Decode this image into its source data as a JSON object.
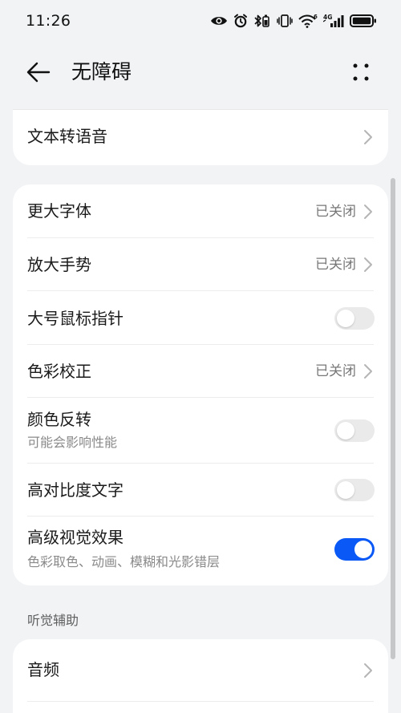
{
  "status_bar": {
    "time": "11:26",
    "icons": [
      "eye-comfort-icon",
      "alarm-icon",
      "bluetooth-icon",
      "vibrate-icon",
      "wifi-icon",
      "cellular-signal-icon",
      "battery-icon"
    ],
    "wifi_badge": "6",
    "signal_badge": "4G"
  },
  "app_bar": {
    "title": "无障碍"
  },
  "main": {
    "card1": {
      "items": [
        {
          "label": "文本转语音",
          "type": "link"
        }
      ]
    },
    "card2": {
      "items": [
        {
          "label": "更大字体",
          "value": "已关闭",
          "type": "link"
        },
        {
          "label": "放大手势",
          "value": "已关闭",
          "type": "link"
        },
        {
          "label": "大号鼠标指针",
          "type": "toggle",
          "checked": false
        },
        {
          "label": "色彩校正",
          "value": "已关闭",
          "type": "link"
        },
        {
          "label": "颜色反转",
          "subtitle": "可能会影响性能",
          "type": "toggle",
          "checked": false
        },
        {
          "label": "高对比度文字",
          "type": "toggle",
          "checked": false
        },
        {
          "label": "高级视觉效果",
          "subtitle": "色彩取色、动画、模糊和光影错层",
          "type": "toggle",
          "checked": true
        }
      ]
    },
    "section_hearing": {
      "title": "听觉辅助",
      "items": [
        {
          "label": "音频",
          "type": "link"
        }
      ]
    }
  },
  "colors": {
    "accent": "#0a59f7",
    "background": "#f1f3f5",
    "card": "#ffffff",
    "secondary_text": "#777777"
  }
}
